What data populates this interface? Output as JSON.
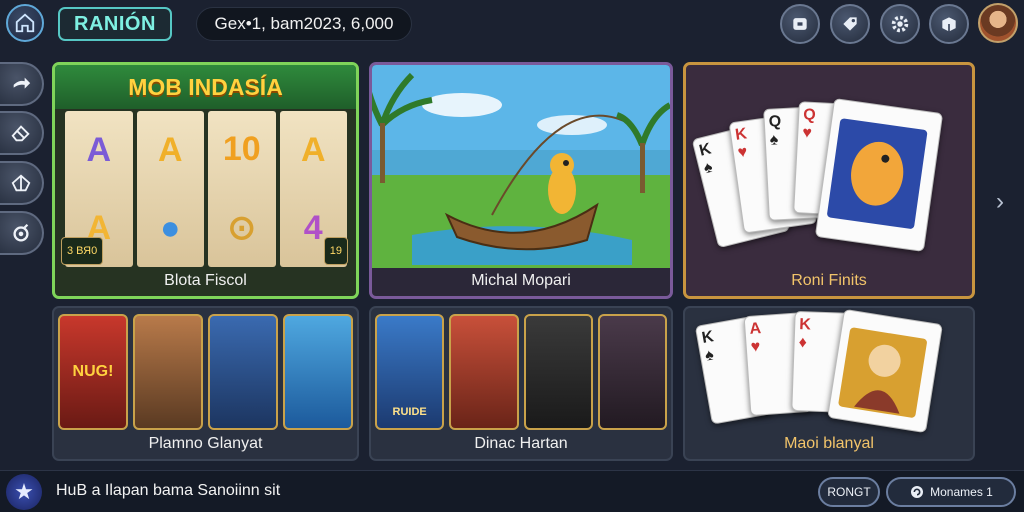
{
  "header": {
    "brand": "RANIÓN",
    "balance": "Gex•1, bam2023, 6,000"
  },
  "icons": {
    "home": "home-icon",
    "top": [
      "wallet-icon",
      "tag-icon",
      "gear-icon",
      "shop-box-icon"
    ],
    "sidebar": [
      "arrow-right-icon",
      "eraser-icon",
      "gift-icon",
      "chat-icon"
    ]
  },
  "games": {
    "featured": [
      {
        "banner": "MOB INDASÍA",
        "label": "Blota Fiscol"
      },
      {
        "label": "Michal Mopari"
      },
      {
        "label": "Roni Finits"
      }
    ],
    "row2": [
      {
        "label": "Plamno Glanyat"
      },
      {
        "label": "Dinac Hartan"
      },
      {
        "label": "Maoi blanyal"
      }
    ]
  },
  "slot": {
    "reel_symbols": [
      [
        "A",
        "A"
      ],
      [
        "A",
        "●"
      ],
      [
        "10",
        "⊙"
      ],
      [
        "A",
        "4"
      ]
    ],
    "badge_left": "3 ВЯ0",
    "badge_right": "19"
  },
  "tiles": {
    "card1": [
      "NUG!",
      "",
      "",
      ""
    ],
    "card2": [
      "RUIDE",
      "",
      "",
      ""
    ]
  },
  "footer": {
    "ticker": "HuB a Ilapan bama Sanoiinn sit",
    "button_primary": "RONGT",
    "button_secondary": "Monames 1"
  },
  "colors": {
    "slot_border": "#7fd45a",
    "fish_border": "#7a5a9a",
    "poker_border": "#c8953f",
    "brand_accent": "#56c7c4"
  }
}
